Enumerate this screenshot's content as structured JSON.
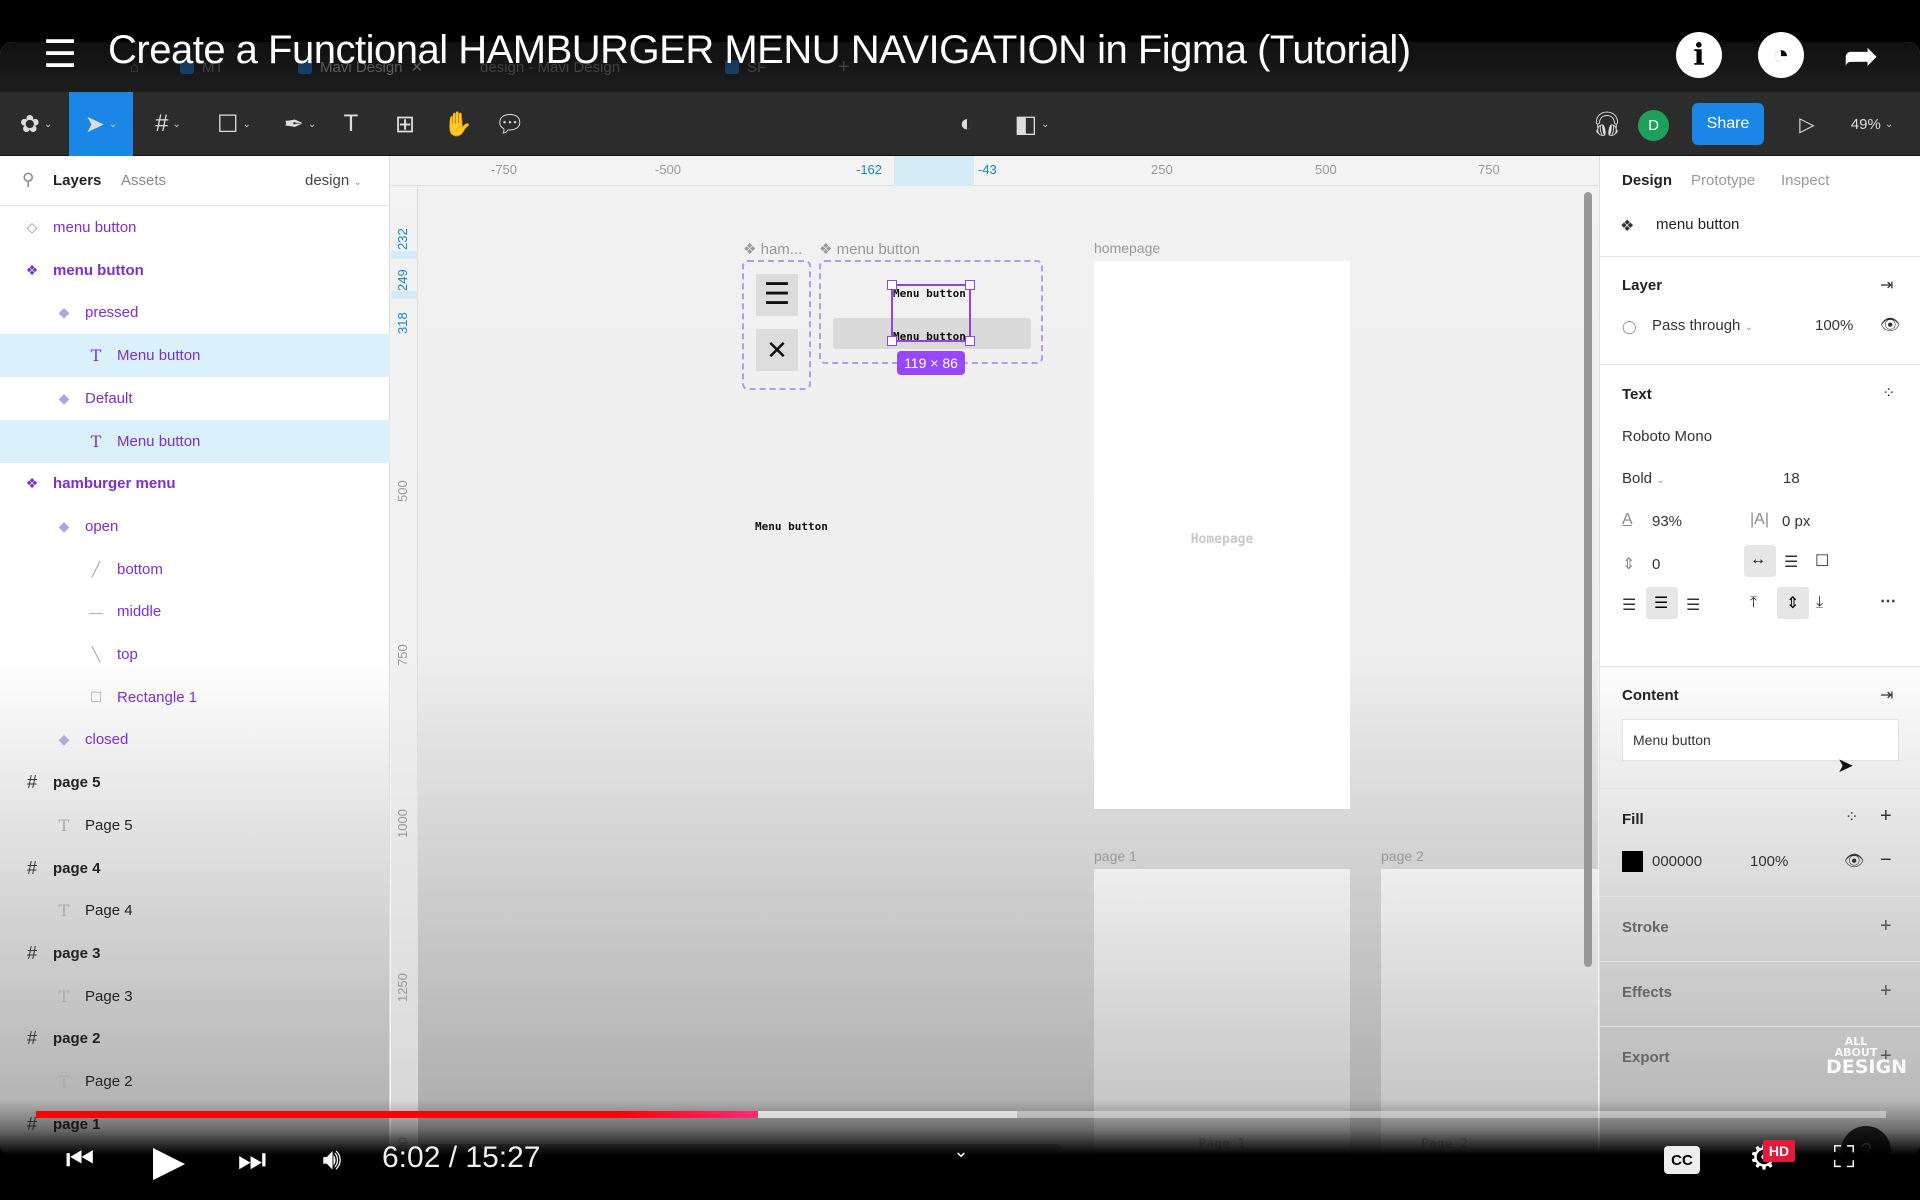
{
  "video": {
    "title": "Create a Functional HAMBURGER MENU NAVIGATION in Figma (Tutorial)",
    "time_current": "6:02",
    "time_total": "15:27",
    "time_display": "6:02 / 15:27",
    "progress_fraction": 0.39,
    "buffer_fraction": 0.53,
    "hd_badge": "HD",
    "cc_label": "CC",
    "watermark_line1": "ALL ABOUT",
    "watermark_line2": "DESIGN"
  },
  "browser_tabs": [
    {
      "label": "MT"
    },
    {
      "label": "Mavi Design",
      "active": true
    },
    {
      "label": "design - Mavi Design"
    },
    {
      "label": "SF"
    }
  ],
  "toolbar": {
    "tools": [
      "figma-menu",
      "move",
      "frame",
      "rectangle",
      "pen",
      "text",
      "components",
      "hand",
      "comment"
    ],
    "avatar_initial": "D",
    "share_label": "Share",
    "zoom_level": "49%"
  },
  "left_panel": {
    "tabs": [
      "Layers",
      "Assets"
    ],
    "page_selector": "design",
    "layers": [
      {
        "label": "menu button",
        "icon": "component-instance",
        "depth": 0,
        "style": "purple"
      },
      {
        "label": "menu button",
        "icon": "component-set",
        "depth": 0,
        "style": "purple-bold"
      },
      {
        "label": "pressed",
        "icon": "variant",
        "depth": 1,
        "style": "purple"
      },
      {
        "label": "Menu button",
        "icon": "text",
        "depth": 2,
        "style": "purple",
        "selected": true
      },
      {
        "label": "Default",
        "icon": "variant",
        "depth": 1,
        "style": "purple"
      },
      {
        "label": "Menu button",
        "icon": "text",
        "depth": 2,
        "style": "purple",
        "selected": true
      },
      {
        "label": "hamburger menu",
        "icon": "component-set",
        "depth": 0,
        "style": "purple-bold"
      },
      {
        "label": "open",
        "icon": "variant",
        "depth": 1,
        "style": "purple"
      },
      {
        "label": "bottom",
        "icon": "line-diag-up",
        "depth": 2,
        "style": "purple"
      },
      {
        "label": "middle",
        "icon": "line-horizontal",
        "depth": 2,
        "style": "purple"
      },
      {
        "label": "top",
        "icon": "line-diag-down",
        "depth": 2,
        "style": "purple"
      },
      {
        "label": "Rectangle 1",
        "icon": "rectangle",
        "depth": 2,
        "style": "purple"
      },
      {
        "label": "closed",
        "icon": "variant",
        "depth": 1,
        "style": "purple"
      },
      {
        "label": "page 5",
        "icon": "frame",
        "depth": 0,
        "style": "dark-bold"
      },
      {
        "label": "Page 5",
        "icon": "text",
        "depth": 1,
        "style": "dark"
      },
      {
        "label": "page 4",
        "icon": "frame",
        "depth": 0,
        "style": "dark-bold"
      },
      {
        "label": "Page 4",
        "icon": "text",
        "depth": 1,
        "style": "dark"
      },
      {
        "label": "page 3",
        "icon": "frame",
        "depth": 0,
        "style": "dark-bold"
      },
      {
        "label": "Page 3",
        "icon": "text",
        "depth": 1,
        "style": "dark"
      },
      {
        "label": "page 2",
        "icon": "frame",
        "depth": 0,
        "style": "dark-bold"
      },
      {
        "label": "Page 2",
        "icon": "text",
        "depth": 1,
        "style": "dark"
      },
      {
        "label": "page 1",
        "icon": "frame",
        "depth": 0,
        "style": "dark-bold"
      }
    ]
  },
  "canvas": {
    "ruler_top": [
      "-750",
      "-500",
      "-162",
      "-43",
      "250",
      "500",
      "750"
    ],
    "ruler_left": [
      "232",
      "249",
      "318",
      "500",
      "750",
      "1000",
      "1250",
      "1500"
    ],
    "component_labels": {
      "hamburger": "ham...",
      "menu_button": "menu button"
    },
    "selection_text_top": "Menu button",
    "selection_text_bottom": "Menu button",
    "selection_size": "119 × 86",
    "loose_text": "Menu button",
    "frames": [
      {
        "label": "homepage",
        "content": "Homepage"
      },
      {
        "label": "page 1",
        "content": "Page  1"
      },
      {
        "label": "page 2",
        "content": "Page  2"
      }
    ]
  },
  "right_panel": {
    "tabs": [
      "Design",
      "Prototype",
      "Inspect"
    ],
    "selection_name": "menu button",
    "layer": {
      "title": "Layer",
      "blend_mode": "Pass through",
      "opacity": "100%"
    },
    "text": {
      "title": "Text",
      "font_family": "Roboto Mono",
      "font_weight": "Bold",
      "font_size": "18",
      "line_height": "93%",
      "letter_spacing": "0 px",
      "paragraph_spacing": "0"
    },
    "content": {
      "title": "Content",
      "value": "Menu button"
    },
    "fill": {
      "title": "Fill",
      "hex": "000000",
      "opacity": "100%",
      "swatch_color": "#000000"
    },
    "stroke_title": "Stroke",
    "effects_title": "Effects",
    "export_title": "Export"
  }
}
